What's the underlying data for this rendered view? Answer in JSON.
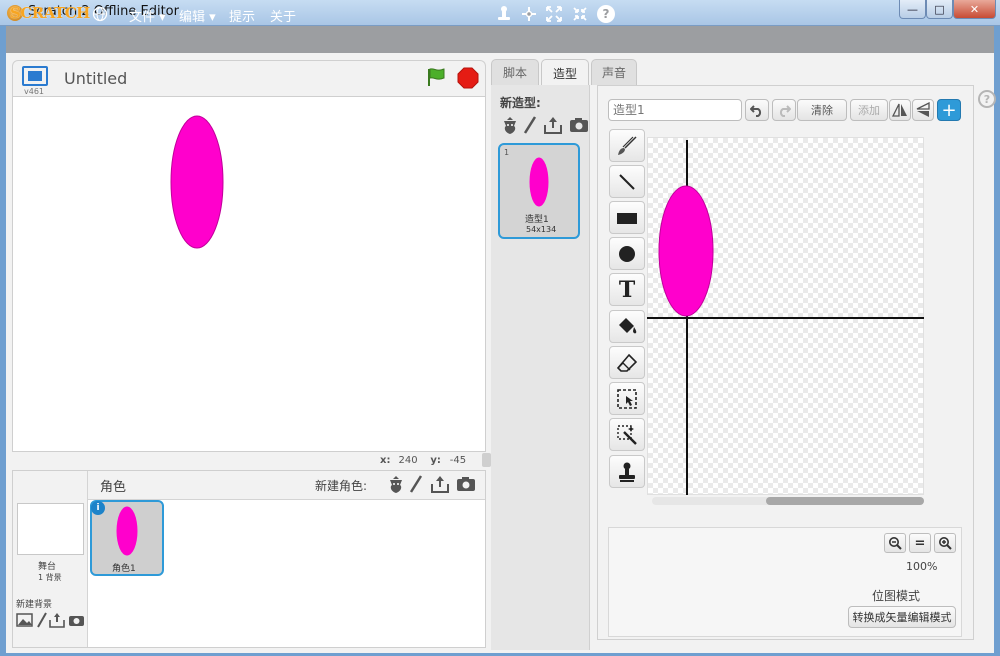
{
  "window": {
    "title": "Scratch 2 Offline Editor",
    "minimize": "—",
    "maximize": "□",
    "close": "✕"
  },
  "menubar": {
    "logo": "SCRATCH",
    "items": [
      {
        "label": "文件 ▾"
      },
      {
        "label": "编辑 ▾"
      },
      {
        "label": "提示"
      },
      {
        "label": "关于"
      }
    ],
    "tool_icons": [
      "duplicate-icon",
      "cut-icon",
      "grow-icon",
      "shrink-icon",
      "help-icon"
    ],
    "help_glyph": "?"
  },
  "stage": {
    "version": "v461",
    "project_title": "Untitled",
    "coords": {
      "x_label": "x:",
      "x_value": "240",
      "y_label": "y:",
      "y_value": "-45"
    }
  },
  "sprites": {
    "header_label": "角色",
    "new_sprite_label": "新建角色:",
    "stage_name": "舞台",
    "stage_backdrops": "1 背景",
    "new_backdrop_label": "新建背景",
    "items": [
      {
        "name": "角色1",
        "info": "i"
      }
    ]
  },
  "tabs": [
    {
      "label": "脚本"
    },
    {
      "label": "造型"
    },
    {
      "label": "声音"
    }
  ],
  "costumes": {
    "new_costume_label": "新造型:",
    "items": [
      {
        "index": "1",
        "name": "造型1",
        "size": "54x134"
      }
    ]
  },
  "editor": {
    "costume_name_placeholder": "造型1",
    "clear_label": "清除",
    "add_label": "添加",
    "help_glyph": "?",
    "center_glyph": "+",
    "tools": [
      "brush-icon",
      "line-icon",
      "rectangle-icon",
      "ellipse-icon",
      "text-icon",
      "fill-icon",
      "eraser-icon",
      "select-icon",
      "magic-wand-icon",
      "stamp-icon"
    ],
    "text_tool_glyph": "T",
    "zoom_level": "100%",
    "zoom_out_glyph": "−",
    "zoom_reset_glyph": "=",
    "zoom_in_glyph": "+",
    "mode_label": "位图模式",
    "convert_label": "转换成矢量编辑模式"
  },
  "colors": {
    "sprite_fill": "#ff00cc",
    "accent": "#2e9ad8",
    "menubar": "#9c9ea1"
  }
}
